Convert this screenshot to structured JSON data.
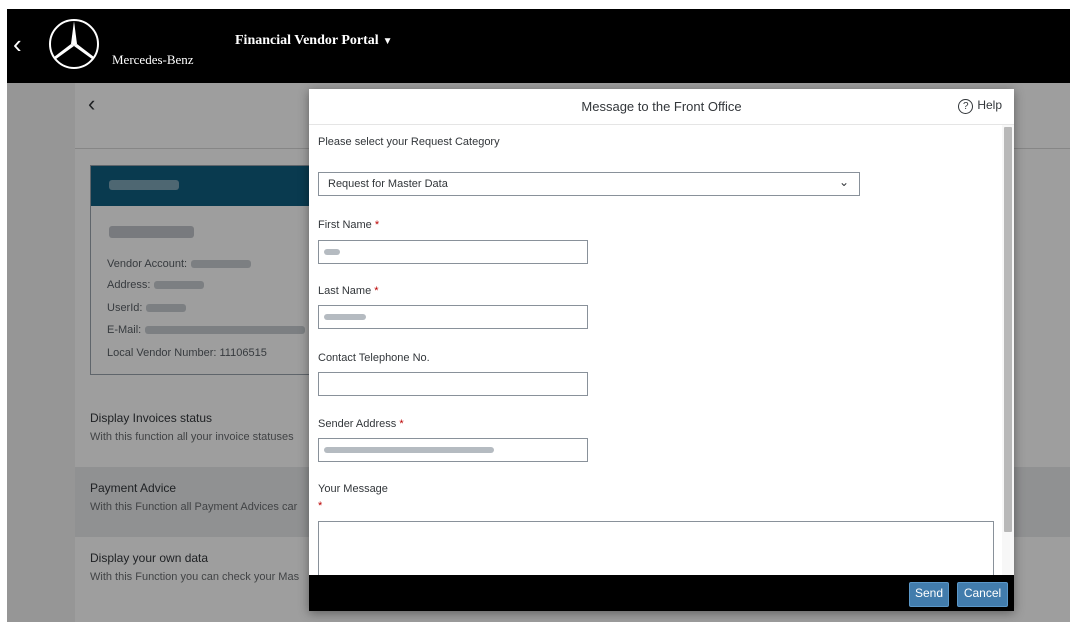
{
  "header": {
    "back_icon": "chevron-left-icon",
    "brand": "Mercedes-Benz",
    "portal_title": "Financial Vendor Portal",
    "portal_caret": "▼"
  },
  "page": {
    "back_icon": "chevron-left-icon",
    "card": {
      "vendor_account_label": "Vendor Account:",
      "address_label": "Address:",
      "userid_label": "UserId:",
      "email_label": "E-Mail:",
      "local_vendor_number": "Local Vendor Number: 11106515"
    },
    "tiles": [
      {
        "title": "Display Invoices status",
        "desc": "With this function all your invoice statuses"
      },
      {
        "title": "Payment Advice",
        "desc": "With this Function all Payment Advices car"
      },
      {
        "title": "Display your own data",
        "desc": "With this Function you can check your Mas"
      }
    ]
  },
  "dialog": {
    "title": "Message to the Front Office",
    "help_label": "Help",
    "category_label": "Please select your Request Category",
    "category_value": "Request for Master Data",
    "first_name_label": "First Name",
    "last_name_label": "Last Name",
    "phone_label": "Contact Telephone No.",
    "sender_label": "Sender Address",
    "message_label": "Your Message",
    "required_mark": "*",
    "send_label": "Send",
    "cancel_label": "Cancel"
  },
  "colors": {
    "header_bg": "#000000",
    "card_header": "#0f5e80",
    "button_bg": "#427cac",
    "required": "#bb0000"
  }
}
